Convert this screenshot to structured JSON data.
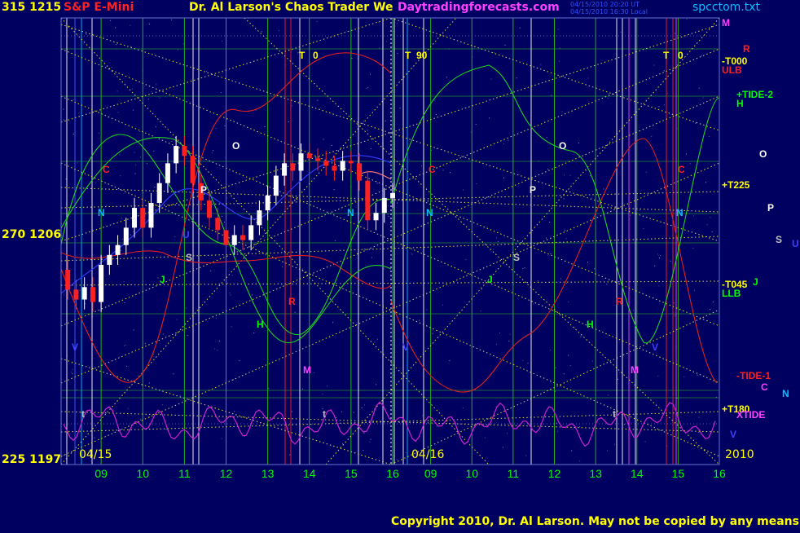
{
  "header": {
    "price_top": "315  1215",
    "instrument": "S&P E-Mini",
    "title": "Dr. Al Larson's Chaos Trader We",
    "website": "Daytradingforecasts.com",
    "timestamp1": "04/15/2010 20:20 UT",
    "timestamp2": "04/15/2010 16:30 Local",
    "file": "spcctom.txt"
  },
  "left_scale": {
    "top": "315  1215",
    "mid": "270  1206",
    "bottom": "225  1197"
  },
  "dates": {
    "start": "04/15",
    "mid": "04/16",
    "year": "2010"
  },
  "hours": [
    "09",
    "10",
    "11",
    "12",
    "13",
    "14",
    "15",
    "16",
    "09",
    "10",
    "11",
    "12",
    "13",
    "14",
    "15",
    "16"
  ],
  "right_labels": [
    {
      "text": "M",
      "color": "#ff40ff"
    },
    {
      "text": "R",
      "color": "#ff2020"
    },
    {
      "text": "-T000",
      "color": "#ffff00"
    },
    {
      "text": "ULB",
      "color": "#ff2020"
    },
    {
      "text": "+TIDE-2",
      "color": "#00ff00"
    },
    {
      "text": "H",
      "color": "#00ff00"
    },
    {
      "text": "O",
      "color": "#ffffff"
    },
    {
      "text": "+T225",
      "color": "#ffff00"
    },
    {
      "text": "P",
      "color": "#ffffff"
    },
    {
      "text": "S",
      "color": "#c0c0c0"
    },
    {
      "text": "U",
      "color": "#4040ff"
    },
    {
      "text": "-T045",
      "color": "#ffff00"
    },
    {
      "text": "J",
      "color": "#00ff00"
    },
    {
      "text": "LLB",
      "color": "#00ff00"
    },
    {
      "text": "-TIDE-1",
      "color": "#ff2020"
    },
    {
      "text": "C",
      "color": "#ff40ff"
    },
    {
      "text": "N",
      "color": "#00c0ff"
    },
    {
      "text": "+T180",
      "color": "#ffff00"
    },
    {
      "text": "XTIDE",
      "color": "#ff40ff"
    },
    {
      "text": "V",
      "color": "#4040ff"
    }
  ],
  "plot_markers": [
    {
      "text": "T",
      "color": "#ffff00"
    },
    {
      "text": "0",
      "color": "#ffff00"
    },
    {
      "text": "T",
      "color": "#ffff00"
    },
    {
      "text": "90",
      "color": "#ffff00"
    },
    {
      "text": "T",
      "color": "#ffff00"
    },
    {
      "text": "0",
      "color": "#ffff00"
    },
    {
      "text": "C",
      "color": "#ff2020"
    },
    {
      "text": "C",
      "color": "#ff2020"
    },
    {
      "text": "C",
      "color": "#ff2020"
    },
    {
      "text": "N",
      "color": "#00c0ff"
    },
    {
      "text": "N",
      "color": "#00c0ff"
    },
    {
      "text": "N",
      "color": "#00c0ff"
    },
    {
      "text": "N",
      "color": "#00c0ff"
    },
    {
      "text": "O",
      "color": "#ffffff"
    },
    {
      "text": "O",
      "color": "#ffffff"
    },
    {
      "text": "P",
      "color": "#ffffff"
    },
    {
      "text": "P",
      "color": "#ffffff"
    },
    {
      "text": "S",
      "color": "#c0c0c0"
    },
    {
      "text": "S",
      "color": "#c0c0c0"
    },
    {
      "text": "U",
      "color": "#4040ff"
    },
    {
      "text": "J",
      "color": "#00ff00"
    },
    {
      "text": "J",
      "color": "#00ff00"
    },
    {
      "text": "H",
      "color": "#00ff00"
    },
    {
      "text": "H",
      "color": "#00ff00"
    },
    {
      "text": "R",
      "color": "#ff2020"
    },
    {
      "text": "R",
      "color": "#ff2020"
    },
    {
      "text": "M",
      "color": "#ff40ff"
    },
    {
      "text": "M",
      "color": "#ff40ff"
    },
    {
      "text": "V",
      "color": "#4040ff"
    },
    {
      "text": "V",
      "color": "#4040ff"
    },
    {
      "text": "V",
      "color": "#4040ff"
    },
    {
      "text": "t",
      "color": "#c0c0c0"
    },
    {
      "text": "t",
      "color": "#c0c0c0"
    },
    {
      "text": "t",
      "color": "#c0c0c0"
    }
  ],
  "copyright": "Copyright 2010, Dr. Al Larson. May not be copied by any means.",
  "colors": {
    "background": "#000060",
    "frame": "#6070d0",
    "hour_labels": "#00ff00",
    "header_red": "#ff2020",
    "title_yellow": "#ffff00",
    "website_magenta": "#ff40ff",
    "file_cyan": "#00c0ff",
    "price_up": "#ffffff",
    "price_down": "#ff2020",
    "red_flux": "#e02020",
    "green_flux": "#20d020",
    "blue_flux": "#3040ff",
    "magenta_osc": "#d020d0",
    "yellow_grid": "#d8d840"
  },
  "chart_data": {
    "type": "line",
    "title": "S&P E-Mini",
    "ylabel_prices": [
      1215,
      1206,
      1197
    ],
    "ylabel_degrees": [
      315,
      270,
      225
    ],
    "ylim": [
      1197,
      1215
    ],
    "x_sessions": [
      "04/15",
      "04/16"
    ],
    "x_hours": [
      "09",
      "10",
      "11",
      "12",
      "13",
      "14",
      "15",
      "16"
    ],
    "price_series": [
      {
        "t": 8.0,
        "v": 1204.6
      },
      {
        "t": 8.2,
        "v": 1203.8
      },
      {
        "t": 8.4,
        "v": 1203.4
      },
      {
        "t": 8.6,
        "v": 1203.9
      },
      {
        "t": 8.8,
        "v": 1203.3
      },
      {
        "t": 9.0,
        "v": 1204.8
      },
      {
        "t": 9.2,
        "v": 1205.2
      },
      {
        "t": 9.4,
        "v": 1205.6
      },
      {
        "t": 9.6,
        "v": 1206.3
      },
      {
        "t": 9.8,
        "v": 1207.1
      },
      {
        "t": 10.0,
        "v": 1206.3
      },
      {
        "t": 10.2,
        "v": 1207.3
      },
      {
        "t": 10.4,
        "v": 1208.1
      },
      {
        "t": 10.6,
        "v": 1208.9
      },
      {
        "t": 10.8,
        "v": 1209.6
      },
      {
        "t": 11.0,
        "v": 1209.2
      },
      {
        "t": 11.2,
        "v": 1208.1
      },
      {
        "t": 11.4,
        "v": 1207.4
      },
      {
        "t": 11.6,
        "v": 1206.7
      },
      {
        "t": 11.8,
        "v": 1206.2
      },
      {
        "t": 12.0,
        "v": 1205.6
      },
      {
        "t": 12.2,
        "v": 1206.0
      },
      {
        "t": 12.4,
        "v": 1205.8
      },
      {
        "t": 12.6,
        "v": 1206.4
      },
      {
        "t": 12.8,
        "v": 1207.0
      },
      {
        "t": 13.0,
        "v": 1207.6
      },
      {
        "t": 13.2,
        "v": 1208.4
      },
      {
        "t": 13.4,
        "v": 1208.9
      },
      {
        "t": 13.6,
        "v": 1208.6
      },
      {
        "t": 13.8,
        "v": 1209.3
      },
      {
        "t": 14.0,
        "v": 1209.1
      },
      {
        "t": 14.2,
        "v": 1209.0
      },
      {
        "t": 14.4,
        "v": 1208.8
      },
      {
        "t": 14.6,
        "v": 1208.6
      },
      {
        "t": 14.8,
        "v": 1209.0
      },
      {
        "t": 15.0,
        "v": 1208.9
      },
      {
        "t": 15.2,
        "v": 1208.2
      },
      {
        "t": 15.4,
        "v": 1206.6
      },
      {
        "t": 15.6,
        "v": 1206.9
      },
      {
        "t": 15.8,
        "v": 1207.5
      },
      {
        "t": 16.0,
        "v": 1207.7
      }
    ]
  }
}
